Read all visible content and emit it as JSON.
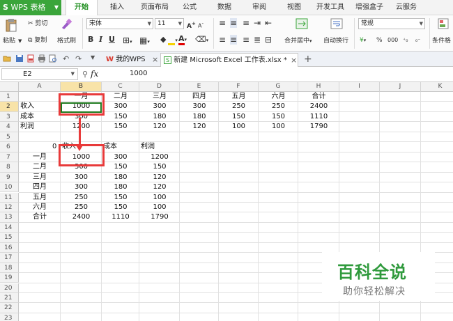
{
  "app": {
    "title": "WPS 表格"
  },
  "menu": {
    "tabs": [
      "开始",
      "插入",
      "页面布局",
      "公式",
      "数据",
      "审阅",
      "视图",
      "开发工具",
      "增强盒子",
      "云服务"
    ],
    "active": "开始"
  },
  "ribbon": {
    "paste": "粘贴",
    "cut": "剪切",
    "copy": "复制",
    "format_painter": "格式刷",
    "font_name": "宋体",
    "font_size": "11",
    "bold": "B",
    "italic": "I",
    "underline": "U",
    "merge_center": "合并居中",
    "wrap_text": "自动换行",
    "number_format": "常规",
    "percent": "%",
    "comma": "000",
    "cond_format": "条件格"
  },
  "tabbar": {
    "tabs": [
      {
        "label": "我的WPS",
        "active": false
      },
      {
        "label": "新建 Microsoft Excel 工作表.xlsx *",
        "active": true
      }
    ],
    "close_glyph": "×",
    "add_glyph": "+",
    "wps_logo": "W"
  },
  "formula_bar": {
    "cell_ref": "E2",
    "fx": "fx",
    "value": "1000"
  },
  "sheet": {
    "columns": [
      "A",
      "B",
      "C",
      "D",
      "E",
      "F",
      "G",
      "H",
      "I",
      "J",
      "K"
    ],
    "rows": [
      "1",
      "2",
      "3",
      "4",
      "5",
      "6",
      "7",
      "8",
      "9",
      "10",
      "11",
      "12",
      "13",
      "14",
      "15",
      "16",
      "17",
      "18",
      "19",
      "20",
      "21",
      "22",
      "23"
    ],
    "selected_column": "B",
    "selected_row": "2",
    "table1": {
      "header": [
        "",
        "一月",
        "二月",
        "三月",
        "四月",
        "五月",
        "六月",
        "合计"
      ],
      "rows": [
        [
          "收入",
          "1000",
          "300",
          "300",
          "300",
          "250",
          "250",
          "2400"
        ],
        [
          "成本",
          "300",
          "150",
          "180",
          "180",
          "150",
          "150",
          "1110"
        ],
        [
          "利润",
          "1200",
          "150",
          "120",
          "120",
          "100",
          "100",
          "1790"
        ]
      ]
    },
    "table2": {
      "corner": "0",
      "header": [
        "收入",
        "成本",
        "利润"
      ],
      "rows": [
        [
          "一月",
          "1000",
          "300",
          "1200"
        ],
        [
          "二月",
          "300",
          "150",
          "150"
        ],
        [
          "三月",
          "300",
          "180",
          "120"
        ],
        [
          "四月",
          "300",
          "180",
          "120"
        ],
        [
          "五月",
          "250",
          "150",
          "100"
        ],
        [
          "六月",
          "250",
          "150",
          "100"
        ],
        [
          "合计",
          "2400",
          "1110",
          "1790"
        ]
      ]
    }
  },
  "watermark": {
    "title": "百科全说",
    "subtitle": "助你轻松解决"
  },
  "colors": {
    "brand_green": "#3aa53a",
    "highlight_red": "#e83a3a",
    "selected_header": "#f8e3a8"
  }
}
